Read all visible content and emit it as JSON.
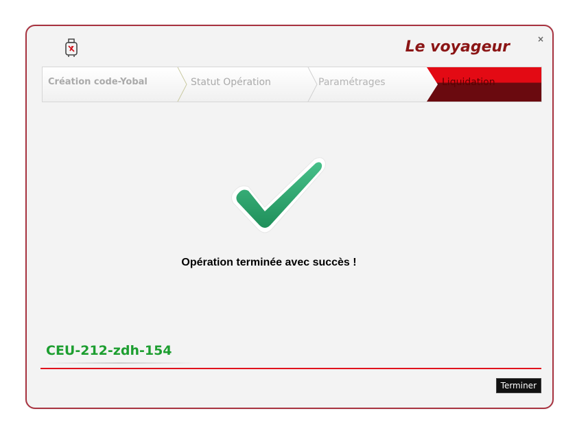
{
  "window": {
    "brand": "Le voyageur",
    "close_label": "×",
    "logo_icon": "suitcase-icon",
    "border_color": "#a8323f",
    "brand_color": "#8b1515"
  },
  "steps": [
    {
      "label": "Création code-Yobal",
      "state": "done"
    },
    {
      "label": "Statut Opération",
      "state": "done"
    },
    {
      "label": "Paramétrages",
      "state": "done"
    },
    {
      "label": "Liquidation",
      "state": "active"
    }
  ],
  "result": {
    "icon": "checkmark-icon",
    "message": "Opération terminée avec succès !",
    "check_color": "#2faa6e"
  },
  "code": {
    "value": "CEU-212-zdh-154",
    "color": "#1d9e30"
  },
  "footer": {
    "finish_label": "Terminer",
    "divider_color": "#e0111c"
  }
}
